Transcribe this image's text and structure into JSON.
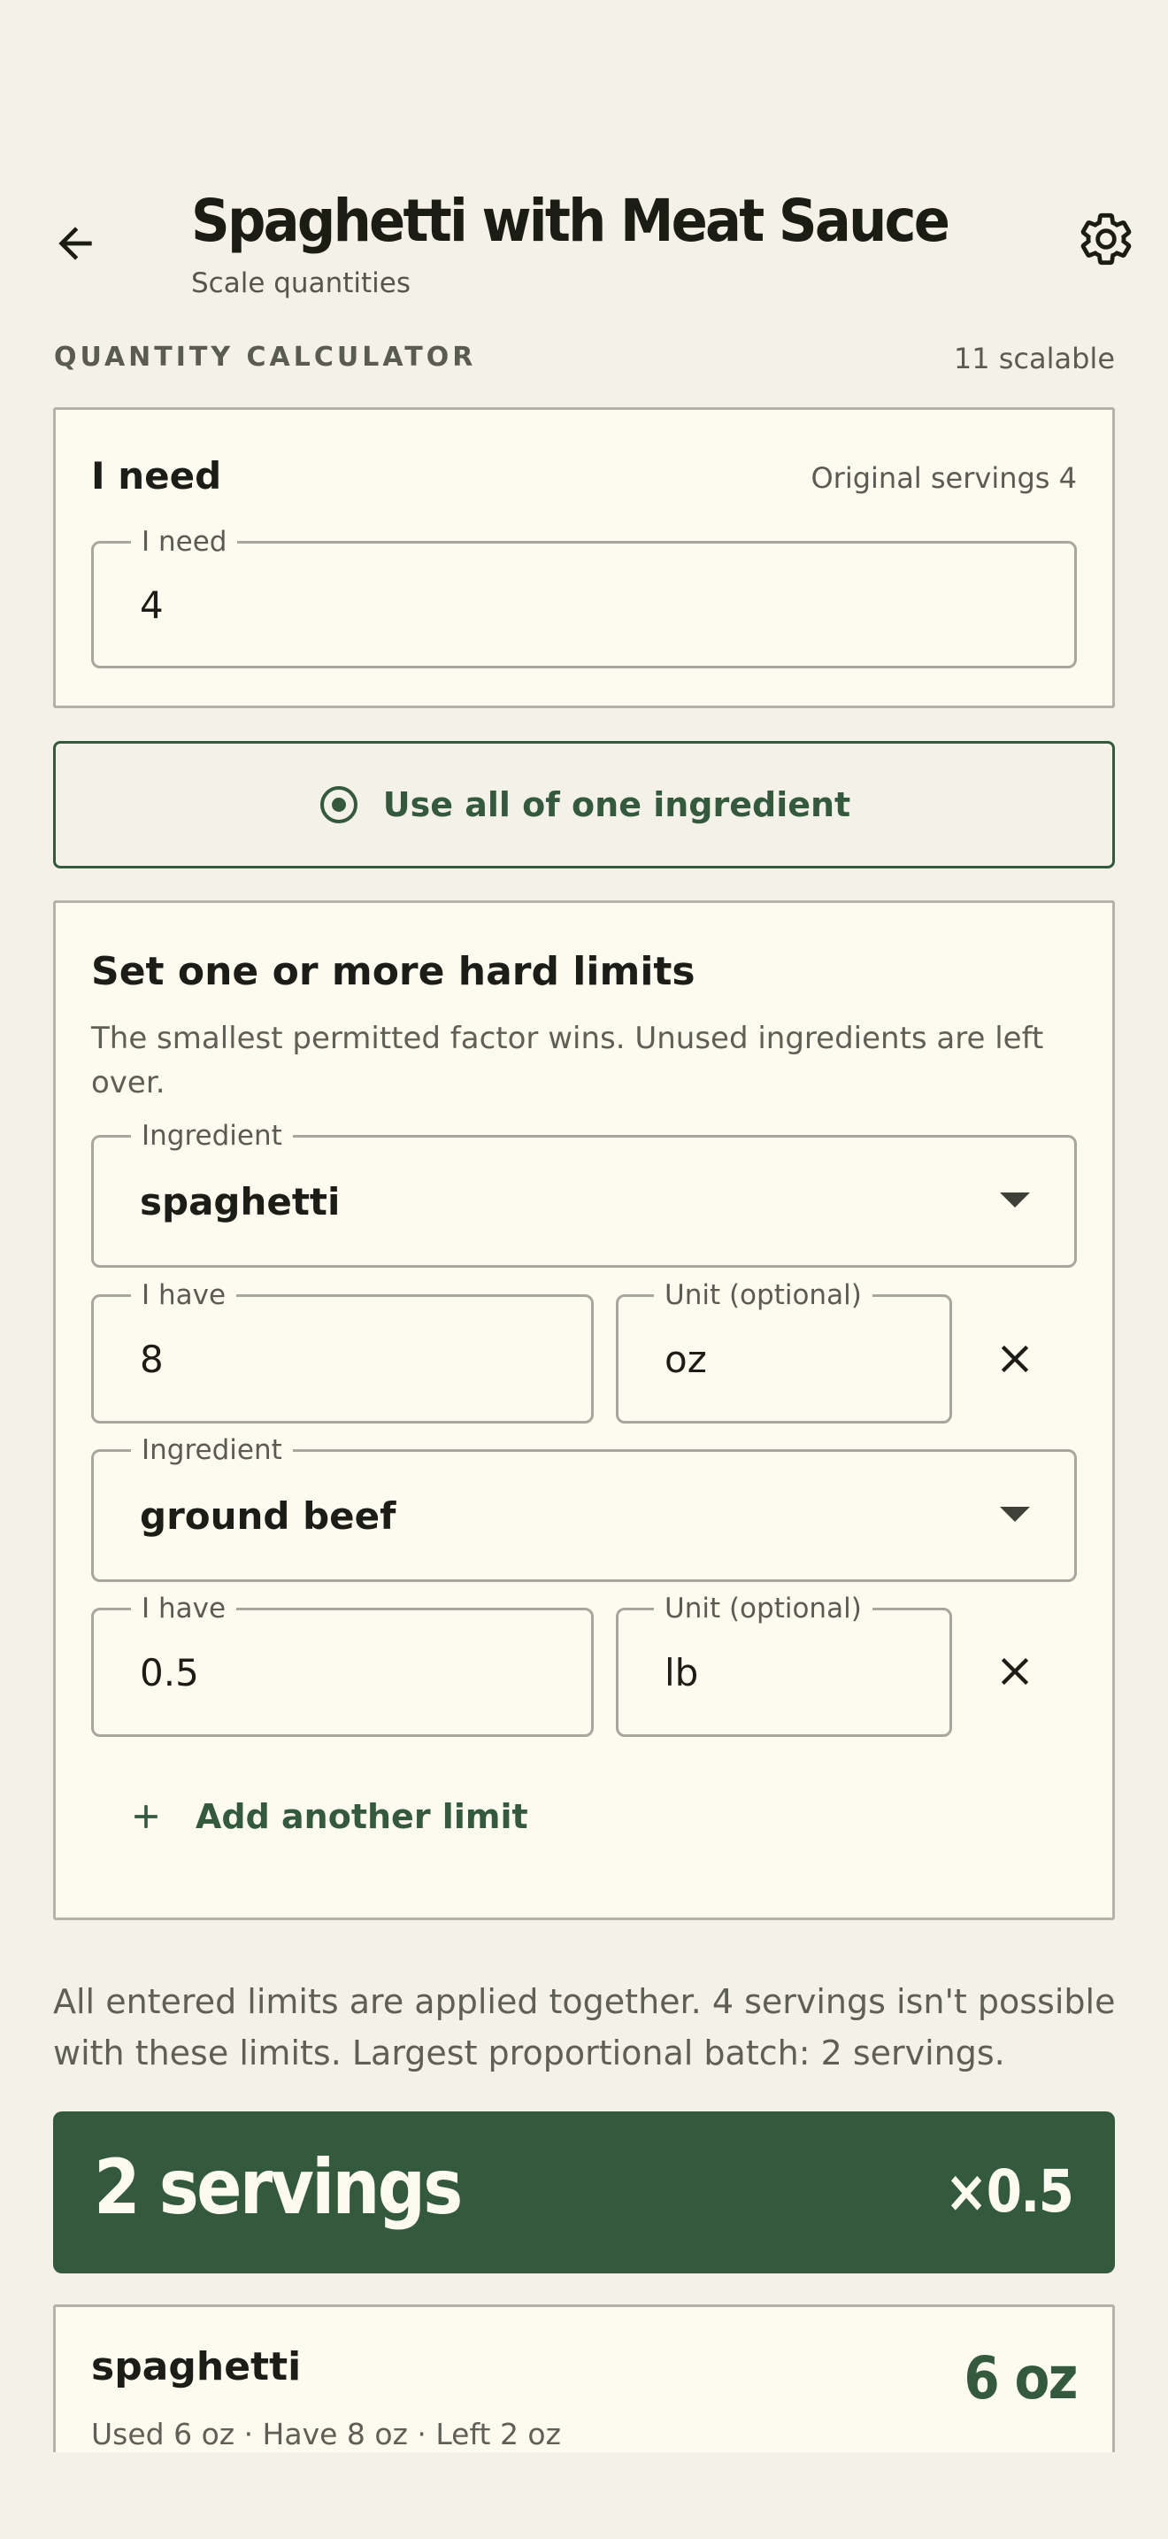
{
  "header": {
    "title": "Spaghetti with Meat Sauce",
    "subtitle": "Scale quantities",
    "back_icon": "arrow-left-icon",
    "settings_icon": "gear-icon"
  },
  "section": {
    "label": "QUANTITY CALCULATOR",
    "count": "11 scalable"
  },
  "need_card": {
    "heading": "I need",
    "original_servings": "Original servings 4",
    "field_label": "I need",
    "field_value": "4"
  },
  "use_all_button": {
    "label": "Use all of one ingredient",
    "icon": "radio-target-icon"
  },
  "limits_card": {
    "heading": "Set one or more hard limits",
    "description": "The smallest permitted factor wins. Unused ingredients are left over.",
    "limits": [
      {
        "ingredient_label": "Ingredient",
        "ingredient": "spaghetti",
        "have_label": "I have",
        "have": "8",
        "unit_label": "Unit (optional)",
        "unit": "oz"
      },
      {
        "ingredient_label": "Ingredient",
        "ingredient": "ground beef",
        "have_label": "I have",
        "have": "0.5",
        "unit_label": "Unit (optional)",
        "unit": "lb"
      }
    ],
    "add_label": "Add another limit"
  },
  "summary": "All entered limits are applied together. 4 servings isn't possible with these limits. Largest proportional batch: 2 servings.",
  "result": {
    "servings": "2 servings",
    "factor": "×0.5"
  },
  "result_items": [
    {
      "name": "spaghetti",
      "quantity": "6 oz",
      "detail": "Used 6 oz · Have 8 oz · Left 2 oz"
    }
  ],
  "colors": {
    "background": "#f4f1e9",
    "card": "#fdfbef",
    "accent": "#345a3e"
  }
}
